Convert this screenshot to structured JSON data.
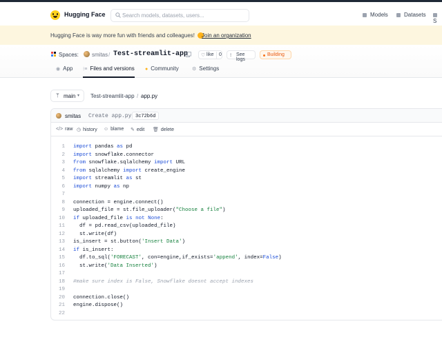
{
  "nav": {
    "brand": "Hugging Face",
    "search_placeholder": "Search models, datasets, users...",
    "links": [
      "Models",
      "Datasets",
      "S"
    ]
  },
  "banner": {
    "text": "Hugging Face is way more fun with friends and colleagues!",
    "join_label": "Join an organization"
  },
  "space": {
    "spaces_label": "Spaces:",
    "user": "smitas",
    "separator": "/",
    "repo": "Test-streamlit-app",
    "like_label": "like",
    "like_count": "0",
    "logs_label": "See logs",
    "status": "Building",
    "tabs": [
      "App",
      "Files and versions",
      "Community",
      "Settings"
    ]
  },
  "file": {
    "branch": "main",
    "crumbs": [
      "Test-streamlit-app",
      "/",
      "app.py"
    ],
    "commit": {
      "author": "smitas",
      "message": "Create app.py",
      "sha": "3c72b6d"
    },
    "actions": [
      "raw",
      "history",
      "blame",
      "edit",
      "delete"
    ]
  },
  "code_lines": [
    "import pandas as pd",
    "import snowflake.connector",
    "from snowflake.sqlalchemy import URL",
    "from sqlalchemy import create_engine",
    "import streamlit as st",
    "import numpy as np",
    "",
    "connection = engine.connect()",
    "uploaded_file = st.file_uploader(\"Choose a file\")",
    "if uploaded_file is not None:",
    "  df = pd.read_csv(uploaded_file)",
    "  st.write(df)",
    "is_insert = st.button('Insert Data')",
    "if is_insert:",
    "  df.to_sql('FORECAST', con=engine,if_exists='append', index=False)",
    "  st.write('Data Inserted')",
    "",
    "#make sure index is False, Snowflake doesnt accept indexes",
    "",
    "connection.close()",
    "engine.dispose()",
    ""
  ],
  "colors": {
    "accent": "#ffd21e",
    "banner_bg": "#fdf6df",
    "building": "#ea580c"
  }
}
